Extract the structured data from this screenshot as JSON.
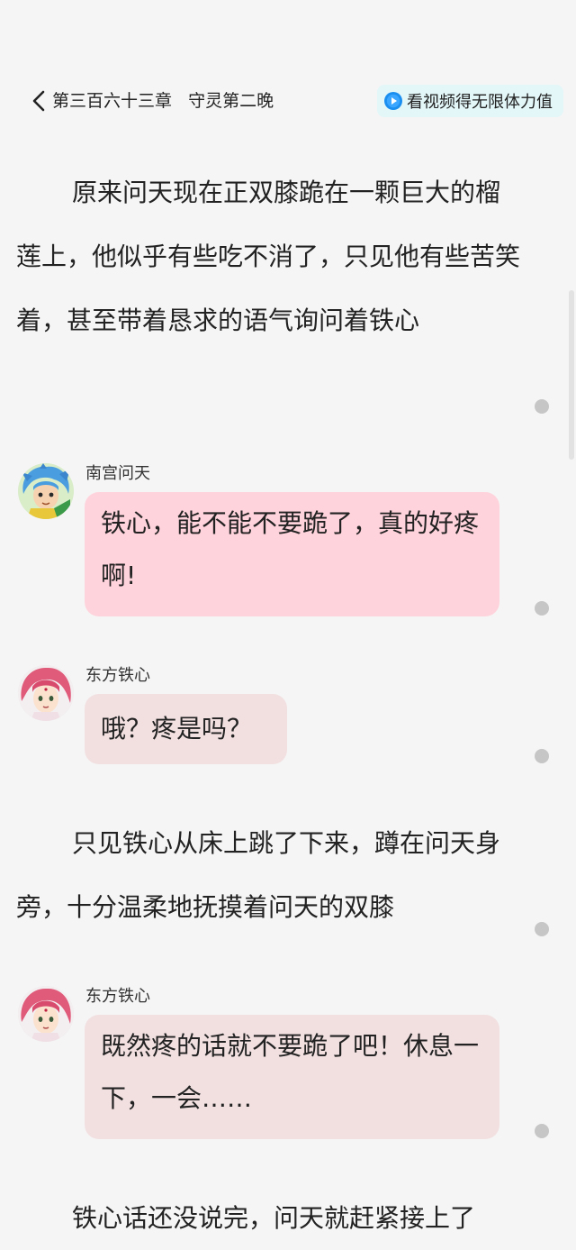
{
  "header": {
    "back_icon": "chevron-left-icon",
    "chapter_title": "第三百六十三章   守灵第二晚",
    "promo": {
      "icon": "play-circle-icon",
      "label": "看视频得无限体力值",
      "icon_color": "#1a8ff0"
    }
  },
  "content": {
    "para1": "原来问天现在正双膝跪在一颗巨大的榴莲上，他似乎有些吃不消了，只见他有些苦笑着，甚至带着恳求的语气询问着铁心",
    "dialog1": {
      "speaker": "南宫问天",
      "text": "铁心，能不能不要跪了，真的好疼啊!"
    },
    "dialog2": {
      "speaker": "东方铁心",
      "text": "哦？疼是吗？"
    },
    "para2": "只见铁心从床上跳了下来，蹲在问天身旁，十分温柔地抚摸着问天的双膝",
    "dialog3": {
      "speaker": "东方铁心",
      "text": "既然疼的话就不要跪了吧！休息一下，一会……"
    },
    "para3": "铁心话还没说完，问天就赶紧接上了"
  },
  "colors": {
    "background": "#f5f5f5",
    "bubble_pink": "#ffd3dc",
    "bubble_beige": "#f2e0e1",
    "promo_bg": "#e3f6f8"
  }
}
